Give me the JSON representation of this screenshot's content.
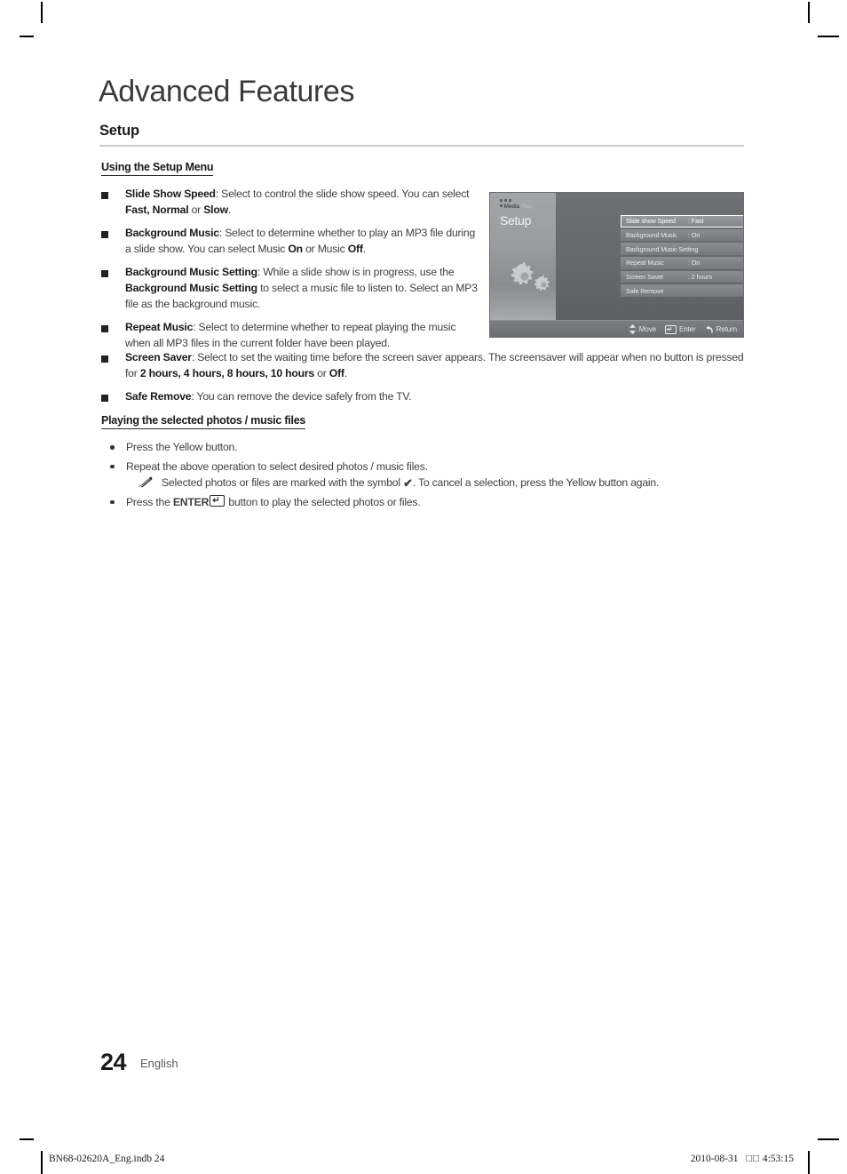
{
  "page": {
    "chapter_title": "Advanced Features",
    "section_title": "Setup",
    "page_number": "24",
    "language": "English"
  },
  "subheads": {
    "using_setup_menu": "Using the Setup Menu",
    "playing_selected": "Playing the selected photos / music files"
  },
  "setup_options": [
    {
      "term": "Slide Show Speed",
      "body_html": "<b>Slide Show Speed</b>: Select to control the slide show speed. You can select <b>Fast, Normal</b> or <b>Slow</b>."
    },
    {
      "term": "Background Music",
      "body_html": "<b>Background Music</b>: Select to determine whether to play an MP3 file during a slide show. You can select Music <b>On</b> or Music <b>Off</b>."
    },
    {
      "term": "Background Music Setting",
      "body_html": "<b>Background Music Setting</b>: While a slide show is in progress, use the <b>Background Music Setting</b> to select a music file to listen to. Select an MP3 file as the background music."
    },
    {
      "term": "Repeat Music",
      "body_html": "<b>Repeat Music</b>: Select to determine whether to repeat playing the music when all MP3 files in the current folder have been played."
    }
  ],
  "setup_options_wide": [
    {
      "term": "Screen Saver",
      "body_html": "<b>Screen Saver</b>: Select to set the waiting time before the screen saver appears. The screensaver will appear when no button is pressed for <b>2 hours, 4 hours, 8 hours, 10 hours</b> or <b>Off</b>."
    },
    {
      "term": "Safe Remove",
      "body_html": "<b>Safe Remove</b>: You can remove the device safely from the TV."
    }
  ],
  "playing_steps": [
    {
      "text_html": "Press the Yellow button."
    },
    {
      "text_html": "Repeat the above operation to select desired photos / music files."
    }
  ],
  "note": {
    "icon": "pencil-note-icon",
    "text_before_check": "Selected photos or files are marked with the symbol ",
    "check_symbol": "✔",
    "text_after_check": ". To cancel a selection, press the Yellow button again."
  },
  "enter_step": {
    "text_before": "Press the ",
    "enter_label": "ENTER",
    "enter_key_icon": "enter-key-icon",
    "text_after": " button to play the selected photos or files."
  },
  "osd": {
    "logo": {
      "brand": "Media",
      "suffix": "Play"
    },
    "heading": "Setup",
    "menu_icon": "gears-icon",
    "rows": [
      {
        "label": "Slide show Speed",
        "value": ": Fast",
        "selected": true,
        "arrow": true
      },
      {
        "label": "Background Music",
        "value": ": On",
        "selected": false,
        "arrow": false
      },
      {
        "label": "Background Music Setting",
        "value": "",
        "selected": false,
        "arrow": false
      },
      {
        "label": "Repeat Music",
        "value": ": On",
        "selected": false,
        "arrow": false
      },
      {
        "label": "Screen Saver",
        "value": ": 2 hours",
        "selected": false,
        "arrow": false
      },
      {
        "label": "Safe Remove",
        "value": "",
        "selected": false,
        "arrow": false
      }
    ],
    "hints": [
      {
        "icon": "up-down-arrows-icon",
        "label": "Move"
      },
      {
        "icon": "enter-key-icon",
        "label": "Enter"
      },
      {
        "icon": "return-arrow-icon",
        "label": "Return"
      }
    ]
  },
  "footer": {
    "left": "BN68-02620A_Eng.indb   24",
    "right_date": "2010-08-31",
    "right_tofu": "□□",
    "right_time": "4:53:15"
  },
  "colors": {
    "rule": "#c9c9c9",
    "body_text": "#3f3f3f",
    "heading": "#3a3a3a",
    "osd_selected_border": "#ffffff"
  }
}
